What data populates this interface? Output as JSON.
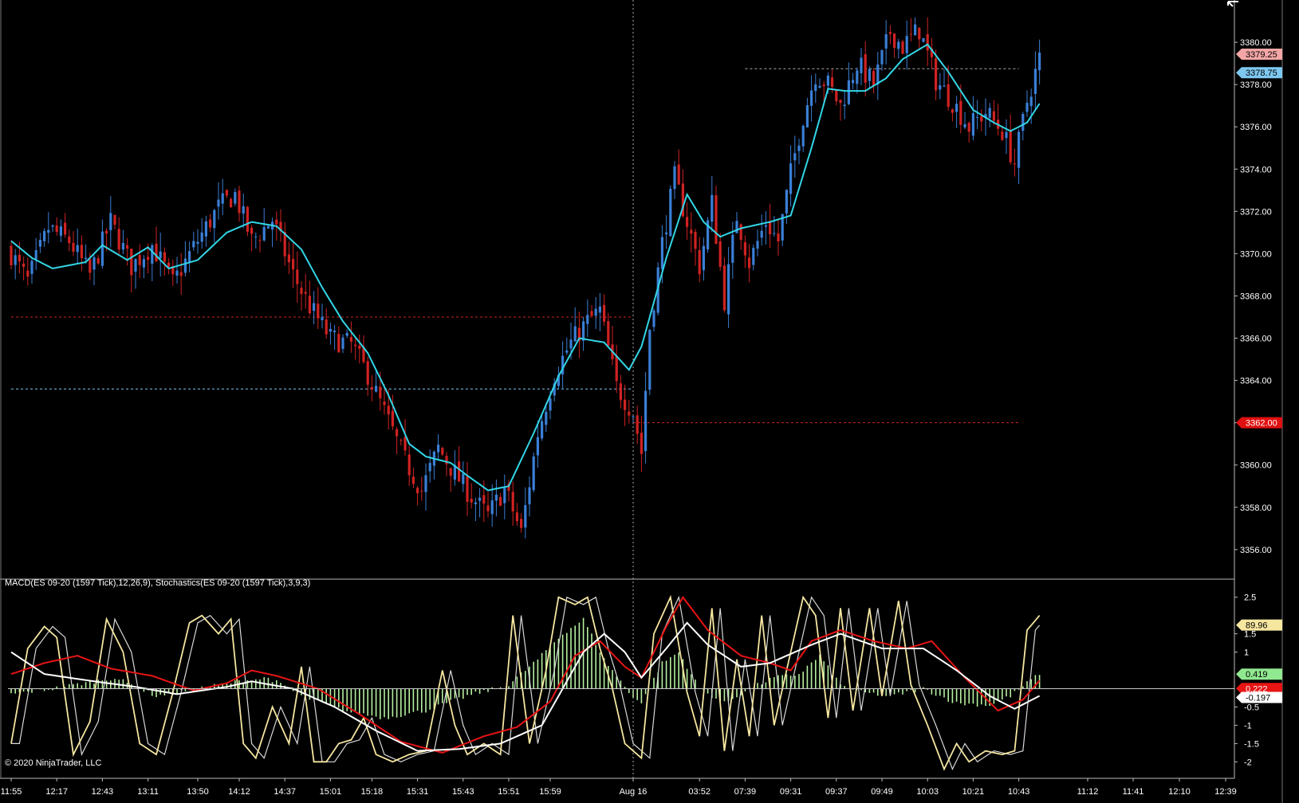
{
  "panel_label": "MACD(ES 09-20 (1597 Tick),12,26,9), Stochastics(ES 09-20 (1597 Tick),3,9,3)",
  "copyright": "© 2020 NinjaTrader, LLC",
  "colors": {
    "background": "#000000",
    "up_candle": "#3a7fd6",
    "down_candle": "#d02222",
    "ema": "#32d6e6",
    "macd": "#ffffff",
    "signal": "#e81414",
    "histogram": "#b6f0a0",
    "stoch_k": "#f5e6a0",
    "stoch_d": "#d8d8d8",
    "grid": "#c8c8c8"
  },
  "chart_data": [
    {
      "type": "candlestick",
      "instrument": "ES 09-20 (1597 Tick)",
      "y_ticks": [
        "3380.00",
        "3378.00",
        "3376.00",
        "3374.00",
        "3372.00",
        "3370.00",
        "3368.00",
        "3366.00",
        "3364.00",
        "3362.00",
        "3360.00",
        "3358.00",
        "3356.00"
      ],
      "ylim": [
        3354.6,
        3382.0
      ],
      "x_ticks": [
        "11:55",
        "12:17",
        "12:43",
        "13:11",
        "13:50",
        "14:12",
        "14:37",
        "15:01",
        "15:18",
        "15:31",
        "15:43",
        "15:51",
        "15:59",
        "Aug 16",
        "03:52",
        "07:39",
        "09:31",
        "09:37",
        "09:49",
        "10:03",
        "10:21",
        "10:43",
        "11:12",
        "11:41",
        "12:10",
        "12:39"
      ],
      "session_break": "Aug 16",
      "price_markers": [
        {
          "label": "3379.25",
          "value": 3379.25,
          "color": "#f4a6a6"
        },
        {
          "label": "3378.75",
          "value": 3378.75,
          "color": "#7ec8f0"
        },
        {
          "label": "3362.00",
          "value": 3362.0,
          "color": "#e01010"
        }
      ],
      "reference_lines": [
        {
          "value": 3367.0,
          "color": "#d02222",
          "from": "11:55",
          "to": "Aug 16"
        },
        {
          "value": 3363.6,
          "color": "#7ec8f0",
          "from": "11:55",
          "to": "Aug 16"
        },
        {
          "value": 3362.0,
          "color": "#d02222",
          "from": "Aug 16",
          "to": "10:43"
        },
        {
          "value": 3378.75,
          "color": "#aaaaaa",
          "from": "07:39",
          "to": "10:43"
        }
      ],
      "ema_anchors": [
        [
          0,
          3370.6
        ],
        [
          5,
          3369.8
        ],
        [
          10,
          3369.3
        ],
        [
          18,
          3369.6
        ],
        [
          22,
          3370.4
        ],
        [
          28,
          3369.7
        ],
        [
          33,
          3370.3
        ],
        [
          38,
          3369.3
        ],
        [
          45,
          3369.7
        ],
        [
          52,
          3371.0
        ],
        [
          58,
          3371.5
        ],
        [
          64,
          3371.3
        ],
        [
          70,
          3370.2
        ],
        [
          75,
          3368.4
        ],
        [
          80,
          3366.8
        ],
        [
          86,
          3365.3
        ],
        [
          91,
          3363.3
        ],
        [
          96,
          3361.0
        ],
        [
          100,
          3360.4
        ],
        [
          106,
          3360.1
        ],
        [
          110,
          3359.5
        ],
        [
          115,
          3358.8
        ],
        [
          120,
          3359.0
        ],
        [
          126,
          3361.5
        ],
        [
          132,
          3364.2
        ],
        [
          137,
          3366.0
        ],
        [
          143,
          3365.8
        ],
        [
          149,
          3364.5
        ],
        [
          152,
          3365.6
        ],
        [
          158,
          3369.8
        ],
        [
          163,
          3372.8
        ],
        [
          167,
          3371.5
        ],
        [
          171,
          3370.8
        ],
        [
          176,
          3371.2
        ],
        [
          183,
          3371.5
        ],
        [
          188,
          3371.8
        ],
        [
          193,
          3375.0
        ],
        [
          197,
          3377.8
        ],
        [
          201,
          3377.7
        ],
        [
          206,
          3377.7
        ],
        [
          211,
          3378.3
        ],
        [
          215,
          3379.2
        ],
        [
          221,
          3379.9
        ],
        [
          226,
          3378.6
        ],
        [
          232,
          3376.8
        ],
        [
          237,
          3376.2
        ],
        [
          241,
          3375.8
        ],
        [
          245,
          3376.2
        ],
        [
          248,
          3377.1
        ]
      ],
      "close_anchors": [
        [
          0,
          3370.0
        ],
        [
          4,
          3368.7
        ],
        [
          9,
          3371.2
        ],
        [
          14,
          3370.6
        ],
        [
          19,
          3369.0
        ],
        [
          24,
          3371.5
        ],
        [
          29,
          3369.4
        ],
        [
          34,
          3370.4
        ],
        [
          39,
          3368.6
        ],
        [
          44,
          3370.3
        ],
        [
          50,
          3372.2
        ],
        [
          54,
          3372.8
        ],
        [
          58,
          3370.6
        ],
        [
          63,
          3371.6
        ],
        [
          68,
          3369.0
        ],
        [
          72,
          3367.5
        ],
        [
          77,
          3366.0
        ],
        [
          82,
          3365.7
        ],
        [
          86,
          3364.3
        ],
        [
          90,
          3362.5
        ],
        [
          95,
          3360.2
        ],
        [
          99,
          3358.8
        ],
        [
          103,
          3360.8
        ],
        [
          107,
          3359.6
        ],
        [
          111,
          3358.5
        ],
        [
          115,
          3357.6
        ],
        [
          119,
          3358.9
        ],
        [
          123,
          3356.8
        ],
        [
          127,
          3361.5
        ],
        [
          131,
          3364.3
        ],
        [
          135,
          3365.8
        ],
        [
          139,
          3366.8
        ],
        [
          142,
          3367.3
        ],
        [
          146,
          3363.7
        ],
        [
          150,
          3362.5
        ],
        [
          152,
          3360.6
        ],
        [
          154,
          3366.5
        ],
        [
          157,
          3370.5
        ],
        [
          160,
          3373.6
        ],
        [
          163,
          3371.5
        ],
        [
          166,
          3369.4
        ],
        [
          169,
          3372.4
        ],
        [
          172,
          3367.8
        ],
        [
          175,
          3371.8
        ],
        [
          178,
          3369.6
        ],
        [
          182,
          3371.5
        ],
        [
          185,
          3370.6
        ],
        [
          188,
          3373.8
        ],
        [
          191,
          3376.5
        ],
        [
          194,
          3378.5
        ],
        [
          197,
          3378.0
        ],
        [
          200,
          3377.0
        ],
        [
          204,
          3379.0
        ],
        [
          208,
          3378.0
        ],
        [
          212,
          3380.5
        ],
        [
          215,
          3379.8
        ],
        [
          219,
          3380.6
        ],
        [
          223,
          3378.2
        ],
        [
          227,
          3377.2
        ],
        [
          231,
          3376.0
        ],
        [
          235,
          3376.7
        ],
        [
          239,
          3375.8
        ],
        [
          242,
          3374.3
        ],
        [
          245,
          3377.2
        ],
        [
          248,
          3379.25
        ]
      ]
    },
    {
      "type": "line",
      "name": "MACD / Stochastics panel",
      "y_ticks": [
        "2.5",
        "1.5",
        "1",
        "-0.5",
        "-1",
        "-1.5",
        "-2"
      ],
      "ylim": [
        -2.45,
        2.95
      ],
      "markers": [
        {
          "label": "89.96",
          "color": "#f5e6a0"
        },
        {
          "label": "0.419",
          "color": "#90e890"
        },
        {
          "label": "0.222",
          "color": "#e81414"
        },
        {
          "label": "-0.197",
          "color": "#ffffff"
        }
      ],
      "macd_anchors": [
        [
          0,
          1.0
        ],
        [
          8,
          0.4
        ],
        [
          20,
          0.2
        ],
        [
          30,
          0.05
        ],
        [
          40,
          -0.15
        ],
        [
          52,
          0.05
        ],
        [
          58,
          0.2
        ],
        [
          68,
          0.0
        ],
        [
          78,
          -0.5
        ],
        [
          88,
          -1.15
        ],
        [
          98,
          -1.7
        ],
        [
          108,
          -1.65
        ],
        [
          118,
          -1.5
        ],
        [
          128,
          -1.0
        ],
        [
          138,
          1.0
        ],
        [
          143,
          1.5
        ],
        [
          148,
          1.0
        ],
        [
          152,
          0.3
        ],
        [
          158,
          1.1
        ],
        [
          163,
          1.8
        ],
        [
          168,
          1.2
        ],
        [
          176,
          0.6
        ],
        [
          183,
          0.7
        ],
        [
          193,
          1.2
        ],
        [
          200,
          1.5
        ],
        [
          210,
          1.1
        ],
        [
          220,
          1.1
        ],
        [
          228,
          0.5
        ],
        [
          236,
          -0.2
        ],
        [
          242,
          -0.55
        ],
        [
          248,
          -0.197
        ]
      ],
      "signal_anchors": [
        [
          0,
          0.4
        ],
        [
          8,
          0.7
        ],
        [
          16,
          0.9
        ],
        [
          24,
          0.55
        ],
        [
          34,
          0.35
        ],
        [
          44,
          -0.05
        ],
        [
          52,
          0.15
        ],
        [
          58,
          0.5
        ],
        [
          64,
          0.35
        ],
        [
          74,
          0.0
        ],
        [
          84,
          -0.7
        ],
        [
          94,
          -1.45
        ],
        [
          104,
          -1.75
        ],
        [
          114,
          -1.3
        ],
        [
          122,
          -1.05
        ],
        [
          130,
          -0.35
        ],
        [
          136,
          0.9
        ],
        [
          142,
          1.3
        ],
        [
          148,
          0.6
        ],
        [
          152,
          0.3
        ],
        [
          158,
          1.7
        ],
        [
          162,
          2.5
        ],
        [
          168,
          1.6
        ],
        [
          176,
          0.9
        ],
        [
          183,
          0.7
        ],
        [
          188,
          0.5
        ],
        [
          193,
          1.3
        ],
        [
          200,
          1.6
        ],
        [
          208,
          1.3
        ],
        [
          216,
          1.1
        ],
        [
          222,
          1.3
        ],
        [
          230,
          0.3
        ],
        [
          238,
          -0.6
        ],
        [
          244,
          -0.3
        ],
        [
          248,
          0.222
        ]
      ],
      "histogram_anchors": [
        [
          0,
          -0.15
        ],
        [
          10,
          0.0
        ],
        [
          25,
          0.3
        ],
        [
          35,
          -0.2
        ],
        [
          45,
          0.0
        ],
        [
          55,
          0.2
        ],
        [
          62,
          0.3
        ],
        [
          70,
          -0.2
        ],
        [
          80,
          -0.6
        ],
        [
          90,
          -0.8
        ],
        [
          100,
          -0.6
        ],
        [
          110,
          -0.2
        ],
        [
          120,
          0.1
        ],
        [
          127,
          0.8
        ],
        [
          133,
          1.5
        ],
        [
          138,
          1.9
        ],
        [
          143,
          0.8
        ],
        [
          149,
          -0.1
        ],
        [
          152,
          -0.4
        ],
        [
          157,
          0.7
        ],
        [
          161,
          1.0
        ],
        [
          166,
          0.0
        ],
        [
          172,
          -0.4
        ],
        [
          178,
          0.0
        ],
        [
          184,
          0.3
        ],
        [
          190,
          0.4
        ],
        [
          195,
          0.9
        ],
        [
          200,
          0.1
        ],
        [
          205,
          -0.1
        ],
        [
          212,
          -0.2
        ],
        [
          220,
          0.0
        ],
        [
          228,
          -0.4
        ],
        [
          236,
          -0.45
        ],
        [
          241,
          -0.2
        ],
        [
          248,
          0.419
        ]
      ],
      "stoch_anchors": [
        [
          0,
          -1.5
        ],
        [
          4,
          1.1
        ],
        [
          8,
          1.7
        ],
        [
          11,
          1.4
        ],
        [
          15,
          -1.8
        ],
        [
          19,
          -0.9
        ],
        [
          23,
          1.9
        ],
        [
          27,
          1.0
        ],
        [
          31,
          -1.5
        ],
        [
          35,
          -1.8
        ],
        [
          39,
          -0.1
        ],
        [
          43,
          1.8
        ],
        [
          46,
          2.0
        ],
        [
          50,
          1.5
        ],
        [
          53,
          1.9
        ],
        [
          56,
          -1.5
        ],
        [
          59,
          -1.9
        ],
        [
          63,
          -0.5
        ],
        [
          67,
          -1.5
        ],
        [
          70,
          0.6
        ],
        [
          73,
          -2.0
        ],
        [
          76,
          -2.0
        ],
        [
          79,
          -1.5
        ],
        [
          82,
          -1.4
        ],
        [
          85,
          -0.8
        ],
        [
          88,
          -1.8
        ],
        [
          92,
          -2.0
        ],
        [
          96,
          -1.8
        ],
        [
          100,
          -1.7
        ],
        [
          104,
          0.5
        ],
        [
          107,
          -1.0
        ],
        [
          110,
          -1.8
        ],
        [
          114,
          -1.5
        ],
        [
          118,
          -1.8
        ],
        [
          121,
          2.0
        ],
        [
          125,
          -1.5
        ],
        [
          129,
          0.5
        ],
        [
          132,
          2.5
        ],
        [
          136,
          2.3
        ],
        [
          139,
          2.5
        ],
        [
          142,
          1.1
        ],
        [
          145,
          0.0
        ],
        [
          148,
          -1.5
        ],
        [
          152,
          -1.9
        ],
        [
          155,
          1.5
        ],
        [
          159,
          2.5
        ],
        [
          163,
          -0.1
        ],
        [
          166,
          -1.3
        ],
        [
          169,
          2.2
        ],
        [
          172,
          -1.7
        ],
        [
          175,
          0.8
        ],
        [
          178,
          -1.3
        ],
        [
          181,
          2.0
        ],
        [
          184,
          -1.0
        ],
        [
          187,
          0.5
        ],
        [
          191,
          2.5
        ],
        [
          194,
          2.0
        ],
        [
          197,
          -0.8
        ],
        [
          200,
          2.2
        ],
        [
          203,
          -0.6
        ],
        [
          207,
          2.2
        ],
        [
          210,
          -0.2
        ],
        [
          214,
          2.4
        ],
        [
          217,
          0.1
        ],
        [
          221,
          -1.0
        ],
        [
          225,
          -2.2
        ],
        [
          228,
          -1.5
        ],
        [
          231,
          -2.0
        ],
        [
          235,
          -1.7
        ],
        [
          239,
          -1.8
        ],
        [
          242,
          -1.7
        ],
        [
          245,
          1.6
        ],
        [
          248,
          2.0
        ]
      ]
    }
  ]
}
